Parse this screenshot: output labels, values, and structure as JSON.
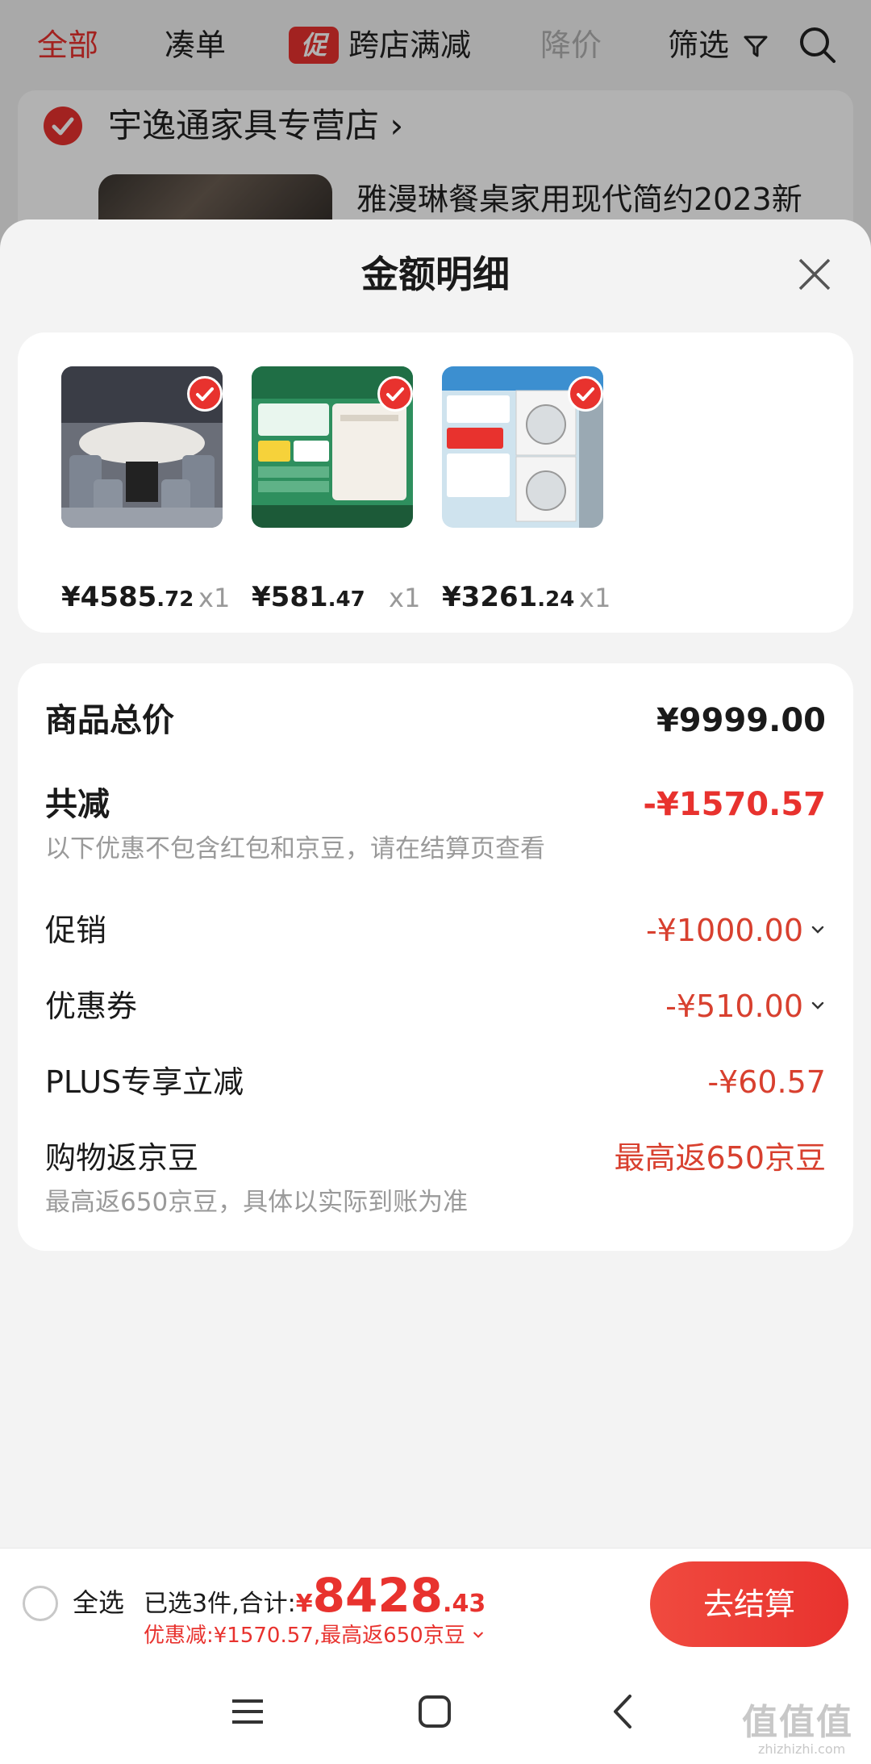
{
  "top_tabs": {
    "all": "全部",
    "bundle": "凑单",
    "promo_badge": "促",
    "cross_store": "跨店满减",
    "price_drop": "降价",
    "filter": "筛选"
  },
  "store": {
    "name": "宇逸通家具专营店",
    "chevron": "›"
  },
  "background_product_title": "雅漫琳餐桌家用现代简约2023新",
  "sheet": {
    "title": "金额明细",
    "items": [
      {
        "price_int": "¥4585",
        "price_dec": ".72",
        "qty": "x1"
      },
      {
        "price_int": "¥581",
        "price_dec": ".47",
        "qty": "x1"
      },
      {
        "price_int": "¥3261",
        "price_dec": ".24",
        "qty": "x1"
      }
    ],
    "summary": {
      "total_label": "商品总价",
      "total_value": "¥9999.00",
      "reduce_label": "共减",
      "reduce_value": "-¥1570.57",
      "reduce_note": "以下优惠不包含红包和京豆，请在结算页查看",
      "promo_label": "促销",
      "promo_value": "-¥1000.00",
      "coupon_label": "优惠券",
      "coupon_value": "-¥510.00",
      "plus_label": "PLUS专享立减",
      "plus_value": "-¥60.57",
      "bean_label": "购物返京豆",
      "bean_value": "最高返650京豆",
      "bean_note": "最高返650京豆，具体以实际到账为准"
    }
  },
  "bottom_bar": {
    "select_all": "全选",
    "selected_prefix": "已选3件,合计:",
    "currency": "¥",
    "total_int": "8428",
    "total_dec": ".43",
    "discount_line": "优惠减:¥1570.57,最高返650京豆",
    "checkout": "去结算"
  },
  "watermark": {
    "text": "值值值",
    "url": "zhizhizhi.com"
  },
  "colors": {
    "accent_red": "#e8322e",
    "sheet_bg": "#f3f3f3"
  }
}
